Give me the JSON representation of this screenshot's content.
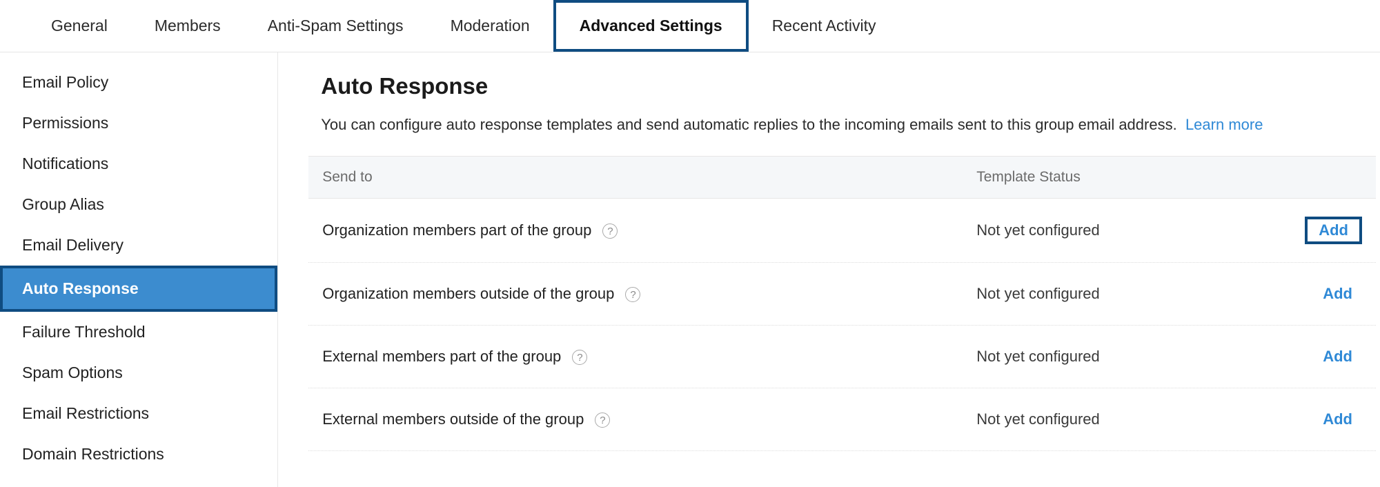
{
  "tabs": {
    "items": [
      {
        "label": "General",
        "active": false
      },
      {
        "label": "Members",
        "active": false
      },
      {
        "label": "Anti-Spam Settings",
        "active": false
      },
      {
        "label": "Moderation",
        "active": false
      },
      {
        "label": "Advanced Settings",
        "active": true
      },
      {
        "label": "Recent Activity",
        "active": false
      }
    ]
  },
  "sidebar": {
    "items": [
      {
        "label": "Email Policy",
        "active": false
      },
      {
        "label": "Permissions",
        "active": false
      },
      {
        "label": "Notifications",
        "active": false
      },
      {
        "label": "Group Alias",
        "active": false
      },
      {
        "label": "Email Delivery",
        "active": false
      },
      {
        "label": "Auto Response",
        "active": true
      },
      {
        "label": "Failure Threshold",
        "active": false
      },
      {
        "label": "Spam Options",
        "active": false
      },
      {
        "label": "Email Restrictions",
        "active": false
      },
      {
        "label": "Domain Restrictions",
        "active": false
      }
    ]
  },
  "main": {
    "title": "Auto Response",
    "description": "You can configure auto response templates and send automatic replies to the incoming emails sent to this group email address.",
    "learn_more": "Learn more"
  },
  "table": {
    "headers": {
      "send_to": "Send to",
      "template_status": "Template Status"
    },
    "rows": [
      {
        "send_to": "Organization members part of the group",
        "status": "Not yet configured",
        "action": "Add",
        "highlight_action": true
      },
      {
        "send_to": "Organization members outside of the group",
        "status": "Not yet configured",
        "action": "Add",
        "highlight_action": false
      },
      {
        "send_to": "External members part of the group",
        "status": "Not yet configured",
        "action": "Add",
        "highlight_action": false
      },
      {
        "send_to": "External members outside of the group",
        "status": "Not yet configured",
        "action": "Add",
        "highlight_action": false
      }
    ]
  }
}
